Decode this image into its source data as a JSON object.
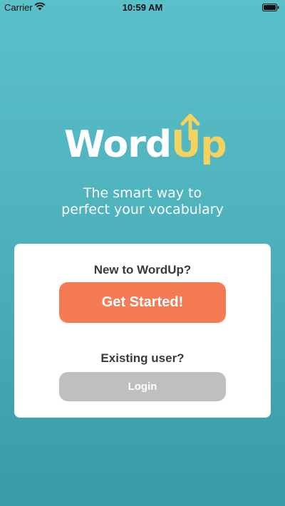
{
  "status_bar": {
    "carrier": "Carrier",
    "time": "10:59 AM"
  },
  "logo": {
    "word": "Word",
    "up": "Up",
    "accent_color": "#f3d35e"
  },
  "tagline": {
    "line1": "The smart way to",
    "line2": "perfect your vocabulary"
  },
  "card": {
    "new_user_heading": "New to WordUp?",
    "get_started_label": "Get Started!",
    "existing_user_heading": "Existing user?",
    "login_label": "Login"
  },
  "colors": {
    "background": "#4eb2bd",
    "primary_button": "#f47b54",
    "secondary_button": "#bfbfbf"
  }
}
